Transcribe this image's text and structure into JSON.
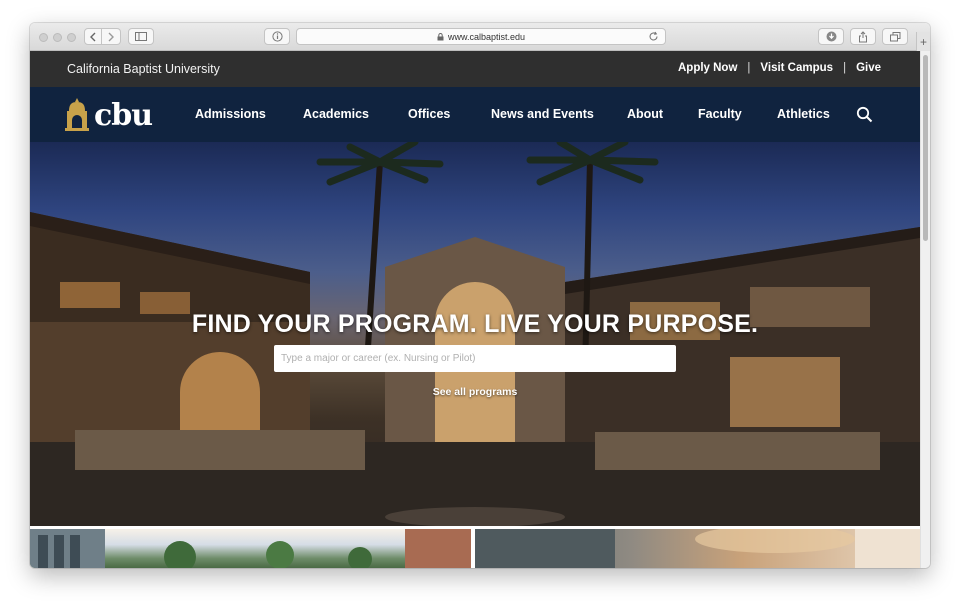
{
  "browser": {
    "url": "www.calbaptist.edu",
    "new_tab_label": "+"
  },
  "topbar": {
    "site_name": "California Baptist University",
    "links": [
      "Apply Now",
      "Visit Campus",
      "Give"
    ],
    "separator": "|"
  },
  "nav": {
    "logo_text": "cbu",
    "items": [
      "Admissions",
      "Academics",
      "Offices",
      "News and Events",
      "About",
      "Faculty",
      "Athletics"
    ],
    "search_icon": "search-icon"
  },
  "hero": {
    "title": "FIND YOUR PROGRAM. LIVE YOUR PURPOSE.",
    "search_placeholder": "Type a major or career (ex. Nursing or Pilot)",
    "see_all": "See all programs"
  },
  "colors": {
    "topbar": "#2f2f2f",
    "nav": "#10233f",
    "logo_gold": "#c8a24a"
  }
}
